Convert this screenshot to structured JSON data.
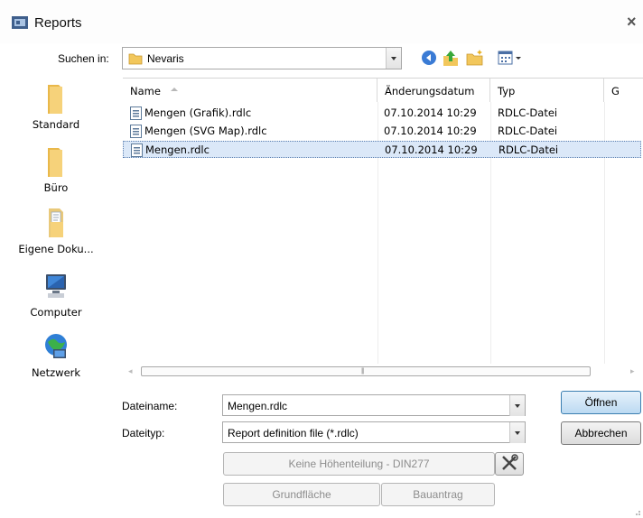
{
  "window": {
    "title": "Reports",
    "close_label": "×"
  },
  "lookin": {
    "label": "Suchen in:",
    "value": "Nevaris"
  },
  "places": [
    {
      "name": "standard",
      "label": "Standard"
    },
    {
      "name": "buero",
      "label": "Büro"
    },
    {
      "name": "eigene-dokumente",
      "label": "Eigene Doku..."
    },
    {
      "name": "computer",
      "label": "Computer"
    },
    {
      "name": "netzwerk",
      "label": "Netzwerk"
    }
  ],
  "columns": {
    "name": "Name",
    "date": "Änderungsdatum",
    "type": "Typ",
    "extra": "G"
  },
  "files": [
    {
      "name": "Mengen (Grafik).rdlc",
      "date": "07.10.2014 10:29",
      "type": "RDLC-Datei"
    },
    {
      "name": "Mengen (SVG Map).rdlc",
      "date": "07.10.2014 10:29",
      "type": "RDLC-Datei"
    },
    {
      "name": "Mengen.rdlc",
      "date": "07.10.2014 10:29",
      "type": "RDLC-Datei",
      "selected": true
    }
  ],
  "filename": {
    "label": "Dateiname:",
    "value": "Mengen.rdlc"
  },
  "filetype": {
    "label": "Dateityp:",
    "value": "Report definition file (*.rdlc)"
  },
  "buttons": {
    "open": "Öffnen",
    "cancel": "Abbrechen",
    "hoehenteilung": "Keine Höhenteilung - DIN277",
    "grundflaeche": "Grundfläche",
    "bauantrag": "Bauantrag"
  },
  "icons": {
    "back": "back-icon",
    "up": "up-folder-icon",
    "new_folder": "new-folder-icon",
    "views": "views-menu-icon",
    "tool": "tools-icon"
  },
  "colors": {
    "selection": "#dbe8f8",
    "accent": "#3c7fb1",
    "folder": "#f2c75c"
  }
}
